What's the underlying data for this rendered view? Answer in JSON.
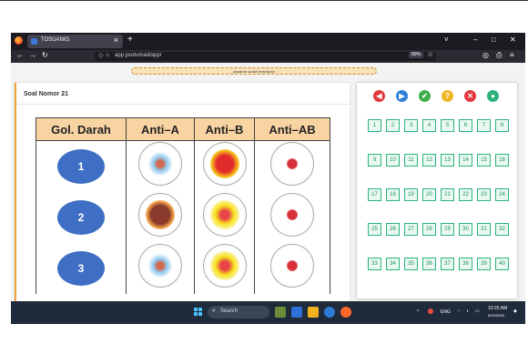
{
  "browser": {
    "tab_title": "TOSUANIG",
    "tab_close": "×",
    "new_tab": "+",
    "url": "app.psotumad/app/",
    "zoom": "80%",
    "window_controls": [
      "˅",
      "–",
      "□",
      "✕"
    ]
  },
  "page": {
    "notice_text": "jawaban sudah tersimpan",
    "question_header": "Soal Nomor 21",
    "table": {
      "headers": [
        "Gol. Darah",
        "Anti–A",
        "Anti–B",
        "Anti–AB"
      ],
      "rows": [
        {
          "label": "1",
          "reactions": [
            "blue-small-red",
            "yellow-red",
            "red-small"
          ]
        },
        {
          "label": "2",
          "reactions": [
            "brown-orange",
            "yellow-red-small",
            "red-small"
          ]
        },
        {
          "label": "3",
          "reactions": [
            "blue-small-red",
            "yellow-red-small",
            "red-small"
          ]
        }
      ]
    }
  },
  "nav_panel": {
    "controls": [
      {
        "icon": "prev-icon",
        "glyph": "◀",
        "color": "#e0393e"
      },
      {
        "icon": "next-icon",
        "glyph": "▶",
        "color": "#2f7fd6"
      },
      {
        "icon": "check-icon",
        "glyph": "✔",
        "color": "#3fae49"
      },
      {
        "icon": "doubt-icon",
        "glyph": "?",
        "color": "#f1b52a"
      },
      {
        "icon": "close-icon",
        "glyph": "✕",
        "color": "#e0393e"
      },
      {
        "icon": "user-icon",
        "glyph": "●",
        "color": "#2bb37a"
      }
    ],
    "question_numbers": [
      [
        "1",
        "2",
        "3",
        "4",
        "5",
        "6",
        "7",
        "8"
      ],
      [
        "9",
        "10",
        "11",
        "12",
        "13",
        "14",
        "15",
        "16"
      ],
      [
        "17",
        "18",
        "19",
        "20",
        "21",
        "22",
        "23",
        "24"
      ],
      [
        "25",
        "26",
        "27",
        "28",
        "29",
        "30",
        "31",
        "32"
      ],
      [
        "33",
        "34",
        "35",
        "36",
        "37",
        "38",
        "39",
        "40"
      ]
    ]
  },
  "taskbar": {
    "search_placeholder": "Search",
    "lang": "ENG",
    "time": "10:25 AM",
    "date": "5/29/2025"
  }
}
